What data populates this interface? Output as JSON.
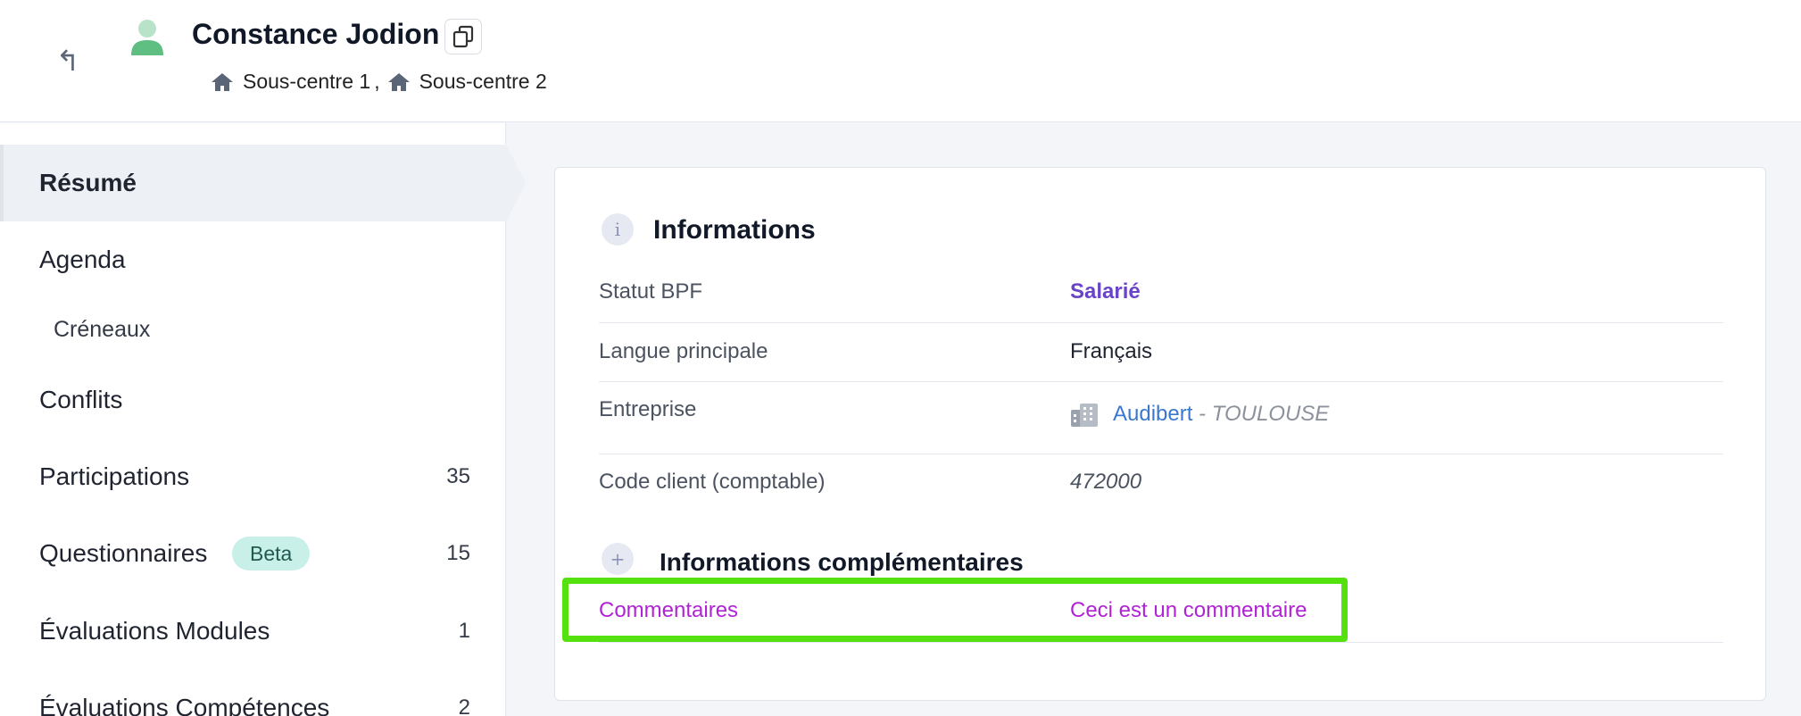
{
  "header": {
    "person_name": "Constance Jodion",
    "centers": [
      "Sous-centre 1",
      "Sous-centre 2"
    ],
    "center_separator": ","
  },
  "sidebar": {
    "items": [
      {
        "label": "Résumé",
        "active": true
      },
      {
        "label": "Agenda"
      },
      {
        "label": "Créneaux",
        "sub": true
      },
      {
        "label": "Conflits"
      },
      {
        "label": "Participations",
        "count": "35"
      },
      {
        "label": "Questionnaires",
        "badge": "Beta",
        "count": "15"
      },
      {
        "label": "Évaluations Modules",
        "count": "1"
      },
      {
        "label": "Évaluations Compétences",
        "count": "2"
      }
    ]
  },
  "card": {
    "info_icon": "i",
    "info_title": "Informations",
    "rows": [
      {
        "label": "Statut BPF",
        "value": "Salarié"
      },
      {
        "label": "Langue principale",
        "value": "Français"
      },
      {
        "label": "Entreprise",
        "company": "Audibert",
        "separator": " - ",
        "city": "TOULOUSE"
      },
      {
        "label": "Code client (comptable)",
        "value": "472000"
      }
    ],
    "extra_icon": "+",
    "extra_title": "Informations complémentaires",
    "extra_rows": [
      {
        "label": "Commentaires",
        "value": "Ceci est un commentaire"
      }
    ]
  },
  "colors": {
    "highlight": "#55e00f",
    "accent_purple": "#6a44c8",
    "comment_magenta": "#b023d4",
    "link_blue": "#3a78d0",
    "badge_bg": "#c8f0e8",
    "avatar_green": "#5fbf82"
  },
  "icons": [
    "back-arrow-icon",
    "user-avatar-icon",
    "copy-icon",
    "home-icon",
    "info-icon",
    "building-icon",
    "plus-icon"
  ]
}
